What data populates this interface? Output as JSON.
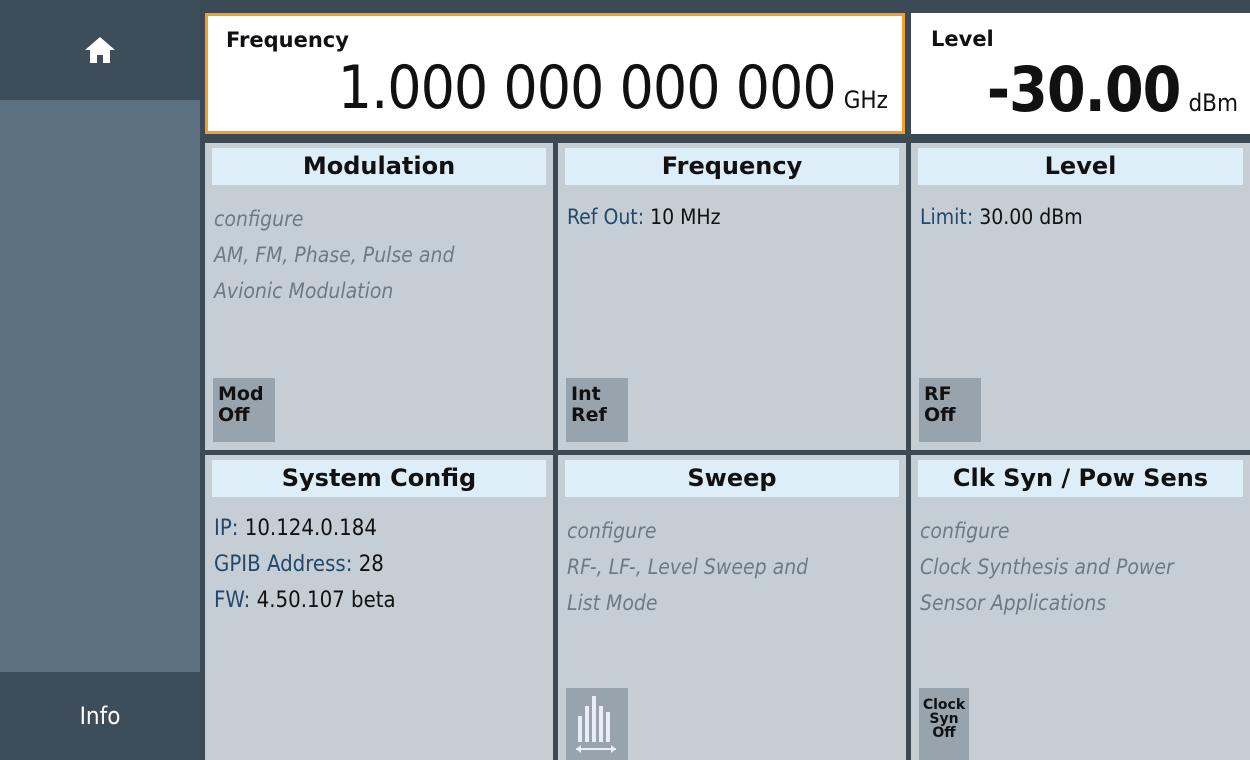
{
  "sidebar": {
    "home_icon": "home-icon",
    "info_label": "Info"
  },
  "frequency_display": {
    "label": "Frequency",
    "value": "1.000 000 000 000",
    "unit": "GHz"
  },
  "level_display": {
    "label": "Level",
    "value": "-30.00",
    "unit": "dBm"
  },
  "tiles": {
    "modulation": {
      "title": "Modulation",
      "line1": "configure",
      "line2": "AM, FM, Phase, Pulse and",
      "line3": "Avionic Modulation",
      "button_line1": "Mod",
      "button_line2": "Off"
    },
    "frequency": {
      "title": "Frequency",
      "ref_out_key": "Ref Out:",
      "ref_out_value": "10 MHz",
      "button_line1": "Int",
      "button_line2": "Ref"
    },
    "level": {
      "title": "Level",
      "limit_key": "Limit:",
      "limit_value": "30.00 dBm",
      "button_line1": "RF",
      "button_line2": "Off"
    },
    "system_config": {
      "title": "System Config",
      "ip_key": "IP:",
      "ip_value": "10.124.0.184",
      "gpib_key": "GPIB Address:",
      "gpib_value": "28",
      "fw_key": "FW:",
      "fw_value": "4.50.107 beta"
    },
    "sweep": {
      "title": "Sweep",
      "line1": "configure",
      "line2": "RF-, LF-, Level Sweep and",
      "line3": "List Mode",
      "button_icon": "sweep-icon"
    },
    "clk_syn": {
      "title": "Clk Syn / Pow Sens",
      "line1": "configure",
      "line2": "Clock Synthesis and Power",
      "line3": "Sensor Applications",
      "button_line1": "Clock",
      "button_line2": "Syn",
      "button_line3": "Off"
    }
  },
  "colors": {
    "accent_border": "#f2a02b",
    "tile_bg": "#c5ced5",
    "tile_title_bg": "#deeef9",
    "key_text": "#23486b"
  }
}
